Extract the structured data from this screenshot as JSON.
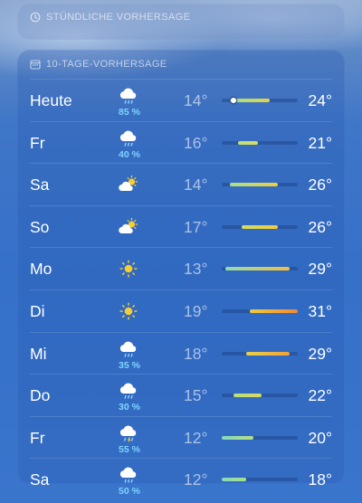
{
  "hourly": {
    "title": "STÜNDLICHE VORHERSAGE",
    "icon": "clock-icon"
  },
  "daily": {
    "title": "10-TAGE-VORHERSAGE",
    "icon": "calendar-icon",
    "range_min": 12,
    "range_max": 31,
    "days": [
      {
        "day": "Heute",
        "icon": "rain-icon",
        "precip": "85 %",
        "lo": "14°",
        "hi": "24°",
        "lo_val": 14,
        "hi_val": 24,
        "now_val": 15,
        "colors": [
          "#a3e08a",
          "#e3d24a"
        ]
      },
      {
        "day": "Fr",
        "icon": "rain-icon",
        "precip": "40 %",
        "lo": "16°",
        "hi": "21°",
        "lo_val": 16,
        "hi_val": 21,
        "colors": [
          "#bfe07a",
          "#d9dc5a"
        ]
      },
      {
        "day": "Sa",
        "icon": "partly-cloudy-icon",
        "precip": "",
        "lo": "14°",
        "hi": "26°",
        "lo_val": 14,
        "hi_val": 26,
        "colors": [
          "#a9e08a",
          "#f0cf3c"
        ]
      },
      {
        "day": "So",
        "icon": "partly-cloudy-icon",
        "precip": "",
        "lo": "17°",
        "hi": "26°",
        "lo_val": 17,
        "hi_val": 26,
        "colors": [
          "#d2dc60",
          "#f2cb38"
        ]
      },
      {
        "day": "Mo",
        "icon": "sun-icon",
        "precip": "",
        "lo": "13°",
        "hi": "29°",
        "lo_val": 13,
        "hi_val": 29,
        "colors": [
          "#8fdcb0",
          "#f5be3a"
        ]
      },
      {
        "day": "Di",
        "icon": "sun-icon",
        "precip": "",
        "lo": "19°",
        "hi": "31°",
        "lo_val": 19,
        "hi_val": 31,
        "colors": [
          "#f0cb3c",
          "#f0883a"
        ]
      },
      {
        "day": "Mi",
        "icon": "rain-icon",
        "precip": "35 %",
        "lo": "18°",
        "hi": "29°",
        "lo_val": 18,
        "hi_val": 29,
        "colors": [
          "#e9d24a",
          "#f3a03a"
        ]
      },
      {
        "day": "Do",
        "icon": "rain-icon",
        "precip": "30 %",
        "lo": "15°",
        "hi": "22°",
        "lo_val": 15,
        "hi_val": 22,
        "colors": [
          "#b6e07c",
          "#d8dc5a"
        ]
      },
      {
        "day": "Fr",
        "icon": "thunderstorm-icon",
        "precip": "55 %",
        "lo": "12°",
        "hi": "20°",
        "lo_val": 12,
        "hi_val": 20,
        "colors": [
          "#86d8c0",
          "#b8e07a"
        ]
      },
      {
        "day": "Sa",
        "icon": "rain-icon",
        "precip": "50 %",
        "lo": "12°",
        "hi": "18°",
        "lo_val": 12,
        "hi_val": 18,
        "colors": [
          "#86d8c0",
          "#a8e088"
        ]
      }
    ]
  }
}
